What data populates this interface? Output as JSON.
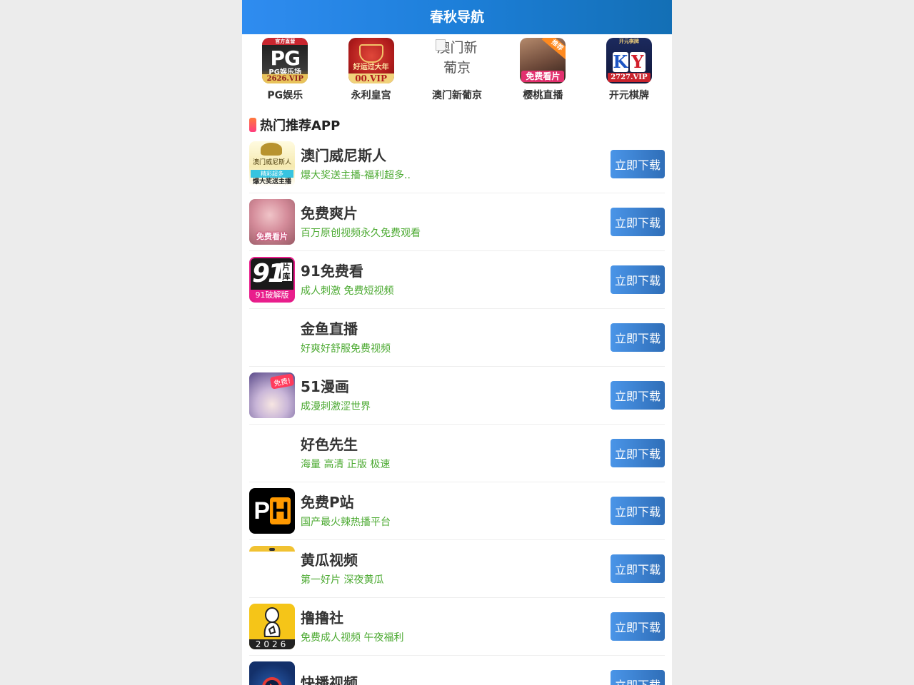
{
  "header": {
    "title": "春秋导航"
  },
  "top_nav": [
    {
      "label": "PG娱乐",
      "icon": "pg-casino-logo",
      "icon_text_main": "PG",
      "icon_text_sub": "PG娱乐场",
      "icon_text_top": "官方直营",
      "icon_text_bottom": "2626.VIP"
    },
    {
      "label": "永利皇宫",
      "icon": "wynn-palace-logo",
      "icon_text_sub": "好运过大年",
      "icon_text_bottom": "00.VIP"
    },
    {
      "label": "澳门新葡京",
      "icon": "broken-image-icon",
      "alt_text": "澳门新葡京"
    },
    {
      "label": "樱桃直播",
      "icon": "cherry-live-logo",
      "icon_text_badge": "推荐",
      "icon_text_bottom": "免费看片"
    },
    {
      "label": "开元棋牌",
      "icon": "ky-chess-logo",
      "icon_text_top": "开元棋牌",
      "icon_text_main": "KY",
      "icon_text_bottom": "2727.VIP"
    }
  ],
  "section": {
    "title": "热门推荐APP"
  },
  "apps": [
    {
      "name": "澳门威尼斯人",
      "desc": "爆大奖送主播-福利超多..",
      "button": "立即下载",
      "icon": "venetian-logo",
      "icon_text_top": "澳门威尼斯人",
      "icon_text_mid": "精彩超多",
      "icon_text_bottom": "爆大奖送主播"
    },
    {
      "name": "免费爽片",
      "desc": "百万原创视频永久免费观看",
      "button": "立即下载",
      "icon": "free-video-icon",
      "icon_text_bottom": "免费看片"
    },
    {
      "name": "91免费看",
      "desc": "成人刺激 免费短视频",
      "button": "立即下载",
      "icon": "91-logo",
      "icon_text_main": "91",
      "icon_text_side": "片库",
      "icon_text_bottom": "91破解版"
    },
    {
      "name": "金鱼直播",
      "desc": "好爽好舒服免费视频",
      "button": "立即下载",
      "icon": "blank-icon"
    },
    {
      "name": "51漫画",
      "desc": "成漫刺激涩世界",
      "button": "立即下载",
      "icon": "comic-icon",
      "icon_text_badge": "免费!"
    },
    {
      "name": "好色先生",
      "desc": "海量 高清 正版 极速",
      "button": "立即下载",
      "icon": "blank-icon"
    },
    {
      "name": "免费P站",
      "desc": "国产最火辣热播平台",
      "button": "立即下载",
      "icon": "ph-logo",
      "icon_text_a": "P",
      "icon_text_b": "H"
    },
    {
      "name": "黄瓜视频",
      "desc": "第一好片 深夜黄瓜",
      "button": "立即下载",
      "icon": "cucumber-icon"
    },
    {
      "name": "撸撸社",
      "desc": "免费成人视频 午夜福利",
      "button": "立即下载",
      "icon": "lulu-logo",
      "icon_text_bottom": "2026"
    },
    {
      "name": "快播视频",
      "desc": "",
      "button": "立即下载",
      "icon": "qvod-logo"
    }
  ]
}
